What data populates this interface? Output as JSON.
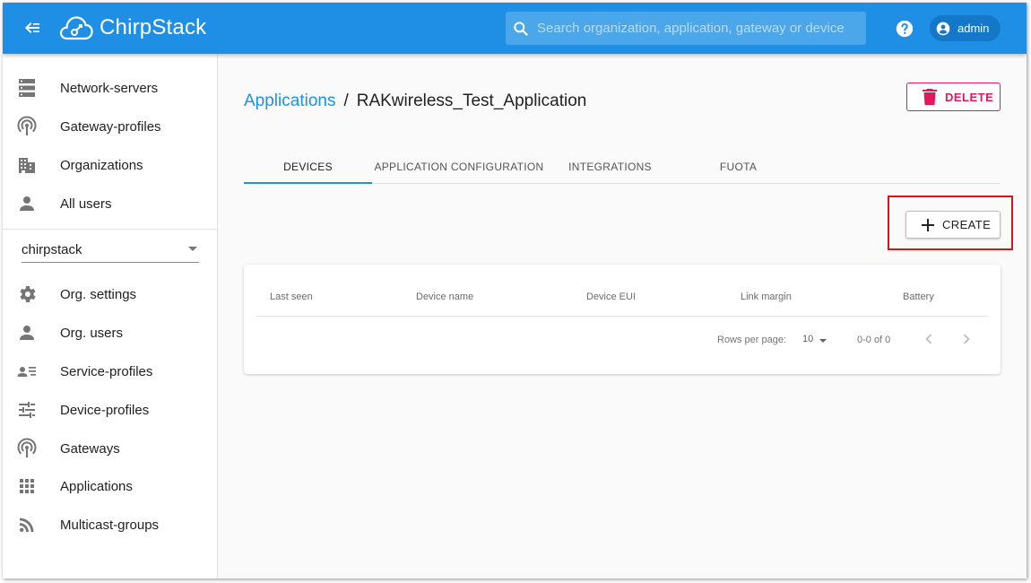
{
  "topbar": {
    "brand": "ChirpStack",
    "search_placeholder": "Search organization, application, gateway or device",
    "user": "admin"
  },
  "sidebar": {
    "global_items": [
      {
        "label": "Network-servers",
        "icon": "server-icon"
      },
      {
        "label": "Gateway-profiles",
        "icon": "gateway-icon"
      },
      {
        "label": "Organizations",
        "icon": "building-icon"
      },
      {
        "label": "All users",
        "icon": "person-icon"
      }
    ],
    "organization": "chirpstack",
    "org_items": [
      {
        "label": "Org. settings",
        "icon": "gear-icon"
      },
      {
        "label": "Org. users",
        "icon": "person-icon"
      },
      {
        "label": "Service-profiles",
        "icon": "account-details-icon"
      },
      {
        "label": "Device-profiles",
        "icon": "tune-icon"
      },
      {
        "label": "Gateways",
        "icon": "gateway-icon"
      },
      {
        "label": "Applications",
        "icon": "apps-grid-icon"
      },
      {
        "label": "Multicast-groups",
        "icon": "rss-icon"
      }
    ]
  },
  "main": {
    "breadcrumb": {
      "parent": "Applications",
      "separator": "/",
      "current": "RAKwireless_Test_Application"
    },
    "delete_label": "DELETE",
    "tabs": [
      "DEVICES",
      "APPLICATION CONFIGURATION",
      "INTEGRATIONS",
      "FUOTA"
    ],
    "active_tab": 0,
    "create_label": "CREATE",
    "table": {
      "columns": [
        "Last seen",
        "Device name",
        "Device EUI",
        "Link margin",
        "Battery"
      ],
      "rows": [],
      "rows_per_page_label": "Rows per page:",
      "rows_per_page": "10",
      "range": "0-0 of 0"
    }
  },
  "colors": {
    "primary": "#1f8fe6",
    "danger": "#e2185b",
    "highlight": "#d9141b"
  }
}
